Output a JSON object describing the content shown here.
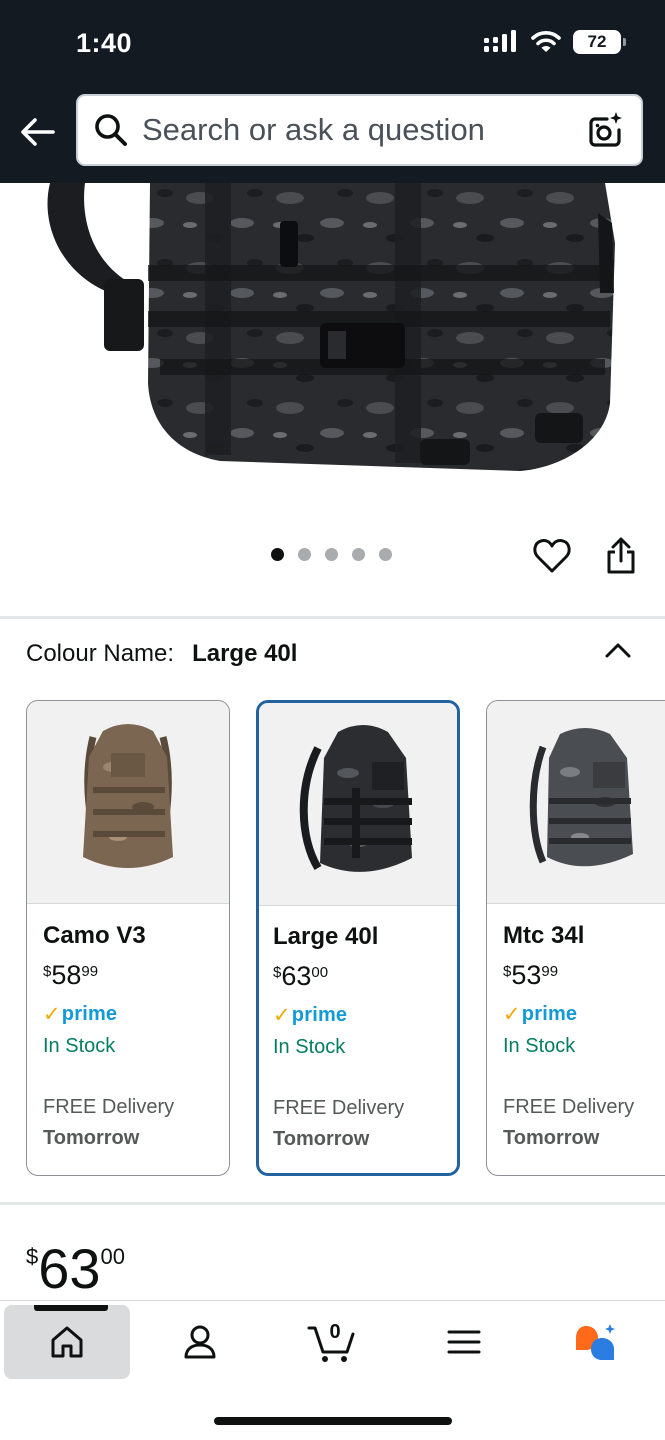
{
  "status_bar": {
    "time": "1:40",
    "battery": "72"
  },
  "search": {
    "placeholder": "Search or ask a question"
  },
  "gallery": {
    "dot_count": 5,
    "active_dot": 1
  },
  "variation": {
    "label": "Colour Name:",
    "selected": "Large 40l",
    "options": [
      {
        "name": "Camo V3",
        "price_symbol": "$",
        "price_whole": "58",
        "price_fraction": "99",
        "prime": "prime",
        "stock": "In Stock",
        "delivery": "FREE Delivery",
        "delivery_day": "Tomorrow",
        "selected": false
      },
      {
        "name": "Large 40l",
        "price_symbol": "$",
        "price_whole": "63",
        "price_fraction": "00",
        "prime": "prime",
        "stock": "In Stock",
        "delivery": "FREE Delivery",
        "delivery_day": "Tomorrow",
        "selected": true
      },
      {
        "name": "Mtc 34l",
        "price_symbol": "$",
        "price_whole": "53",
        "price_fraction": "99",
        "prime": "prime",
        "stock": "In Stock",
        "delivery": "FREE Delivery",
        "delivery_day": "Tomorrow",
        "selected": false
      }
    ]
  },
  "price": {
    "symbol": "$",
    "whole": "63",
    "fraction": "00"
  },
  "bottom_nav": {
    "cart_count": "0",
    "items": [
      "home",
      "account",
      "cart",
      "menu",
      "rufus"
    ]
  },
  "colors": {
    "header": "#131a22",
    "selected_border": "#2162a1",
    "prime_blue": "#1399d6",
    "prime_check": "#f2a900",
    "in_stock": "#067d62"
  }
}
